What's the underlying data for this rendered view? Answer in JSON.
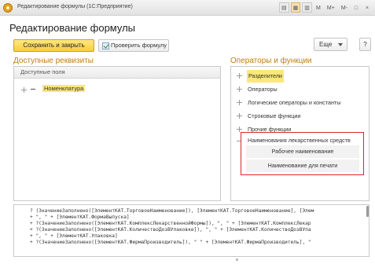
{
  "window": {
    "title": "Редактирование формулы (1С:Предприятие)",
    "buttons": [
      "M",
      "M+",
      "M-"
    ]
  },
  "form": {
    "title": "Редактирование формулы",
    "save_close_label": "Сохранить и закрыть",
    "check_formula_label": "Проверить формулу",
    "more_label": "Еще",
    "help_label": "?"
  },
  "left": {
    "title": "Доступные реквизиты",
    "column_header": "Доступные поля",
    "tree_item": "Номенклатура"
  },
  "right": {
    "title": "Операторы и функции",
    "items": [
      {
        "label": "Разделители",
        "selected": true
      },
      {
        "label": "Операторы"
      },
      {
        "label": "Логические операторы и константы"
      },
      {
        "label": "Строковые функции"
      },
      {
        "label": "Прочие функции"
      },
      {
        "label": "Наименования лекарственных средств"
      }
    ],
    "children": [
      "Рабочее наименование",
      "Наименование для печати"
    ]
  },
  "code": {
    "lines": [
      "? (ЗначениеЗаполнено([ЭлементКАТ.ТорговоеНаименование]), [ЭлементКАТ.ТорговоеНаименование], [Элем",
      "+ \", \" + [ЭлементКАТ.ФормаВыпуска]",
      "+ ?(ЗначениеЗаполнено([ЭлементКАТ.КомплексЛекарственнойФормы]), \", \" + [ЭлементКАТ.КомплексЛекар",
      "+ ?(ЗначениеЗаполнено([ЭлементКАТ.КоличествоДозВУпаковке]), \", \" + [ЭлементКАТ.КоличествоДозВУпа",
      "+ \", \" + [ЭлементКАТ.Упаковка]",
      "+ ?(ЗначениеЗаполнено([ЭлементКАТ.ФирмаПроизводитель]), \" \" + [ЭлементКАТ.ФирмаПроизводитель], \""
    ]
  },
  "colors": {
    "accent_title": "#c27d0e",
    "highlight": "#fbe77a",
    "primary_button": "#f5cf36",
    "annotation_box": "#d9262b"
  }
}
